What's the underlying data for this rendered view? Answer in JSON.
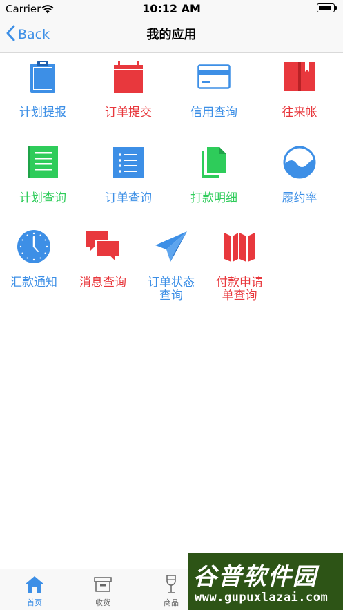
{
  "status_bar": {
    "carrier": "Carrier",
    "time": "10:12 AM"
  },
  "nav": {
    "back_label": "Back",
    "title": "我的应用"
  },
  "apps": [
    {
      "label": "计划提报",
      "icon": "clipboard-icon",
      "color": "#3d8fe6"
    },
    {
      "label": "订单提交",
      "icon": "calendar-icon",
      "color": "#e8383d"
    },
    {
      "label": "信用查询",
      "icon": "credit-card-icon",
      "color": "#3d8fe6"
    },
    {
      "label": "往来帐",
      "icon": "book-icon",
      "color": "#e8383d"
    },
    {
      "label": "计划查询",
      "icon": "document-lines-icon",
      "color": "#2ecc5a"
    },
    {
      "label": "订单查询",
      "icon": "list-icon",
      "color": "#3d8fe6"
    },
    {
      "label": "打款明细",
      "icon": "documents-icon",
      "color": "#2ecc5a"
    },
    {
      "label": "履约率",
      "icon": "wave-gauge-icon",
      "color": "#3d8fe6"
    },
    {
      "label": "汇款通知",
      "icon": "clock-icon",
      "color": "#3d8fe6"
    },
    {
      "label": "消息查询",
      "icon": "chat-bubbles-icon",
      "color": "#e8383d"
    },
    {
      "label": "订单状态\n查询",
      "icon": "paper-plane-icon",
      "color": "#3d8fe6"
    },
    {
      "label": "付款申请\n单查询",
      "icon": "map-icon",
      "color": "#e8383d"
    }
  ],
  "tabs": [
    {
      "label": "首页",
      "icon": "home-icon",
      "active": true
    },
    {
      "label": "收货",
      "icon": "box-icon",
      "active": false
    },
    {
      "label": "商品",
      "icon": "wine-glass-icon",
      "active": false
    }
  ],
  "watermark": {
    "brand": "谷普软件园",
    "url": "www.gupuxlazai.com"
  },
  "colors": {
    "accent": "#3d8fe6",
    "red": "#e8383d",
    "green": "#2ecc5a"
  }
}
